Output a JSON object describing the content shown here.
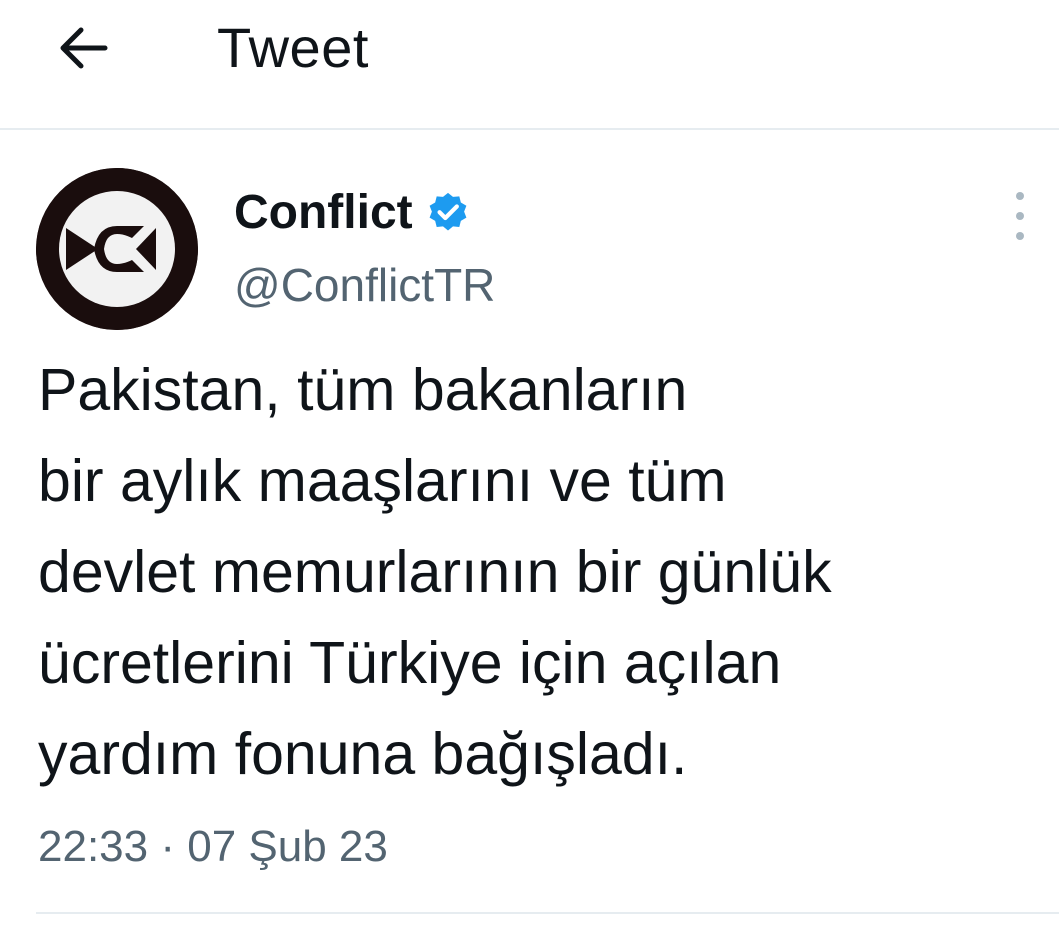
{
  "header": {
    "back_icon": "arrow-left-icon",
    "title": "Tweet"
  },
  "tweet": {
    "author": {
      "display_name": "Conflict",
      "handle": "@ConflictTR",
      "verified": true,
      "verified_color": "#1d9bf0",
      "avatar_icon": "conflict-logo-icon"
    },
    "text": "Pakistan, tüm bakanların\nbir aylık maaşlarını ve tüm\ndevlet memurlarının bir günlük\nücretlerini Türkiye için açılan\nyardım fonuna bağışladı.",
    "time": "22:33",
    "separator": "·",
    "date": "07 Şub 23",
    "more_icon": "more-vertical-icon"
  },
  "colors": {
    "text_primary": "#0f1419",
    "text_secondary": "#536471",
    "divider": "#e6ecf0",
    "verified": "#1d9bf0"
  }
}
